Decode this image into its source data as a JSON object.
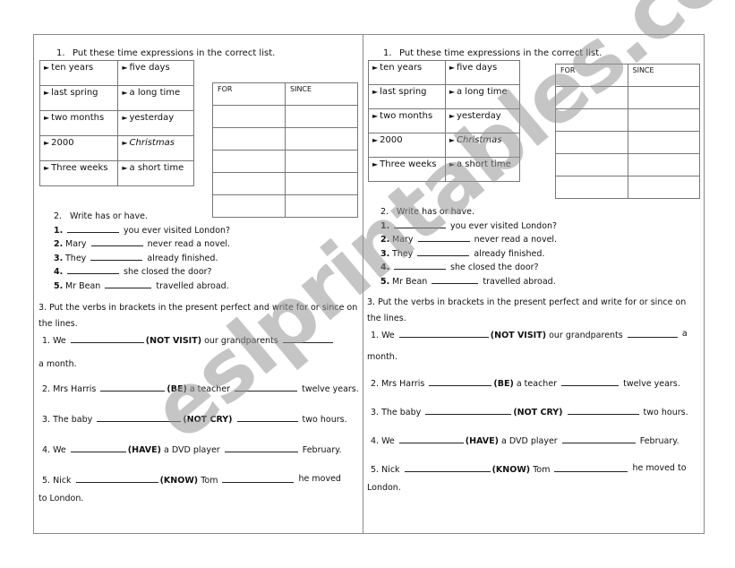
{
  "watermark": "eslprintables.com",
  "worksheet": {
    "exercise1": {
      "number": "1.",
      "title": "Put these time expressions in the correct list.",
      "expressions": [
        [
          "ten years",
          "five days"
        ],
        [
          "last spring",
          "a long time"
        ],
        [
          "two months",
          "yesterday"
        ],
        [
          "2000",
          "Christmas"
        ],
        [
          "Three weeks",
          "a short time"
        ]
      ],
      "arrow": "►",
      "columns": [
        "FOR",
        "SINCE"
      ]
    },
    "exercise2": {
      "number": "2.",
      "title": "Write has or have.",
      "items": [
        {
          "num": "1.",
          "before": "",
          "after": "you ever visited London?"
        },
        {
          "num": "2.",
          "before": "Mary",
          "after": "never read a novel."
        },
        {
          "num": "3.",
          "before": "They",
          "after": "already finished."
        },
        {
          "num": "4.",
          "before": "",
          "after": "she closed the door?"
        },
        {
          "num": "5.",
          "before": "Mr Bean",
          "after": "travelled abroad."
        }
      ]
    },
    "exercise3": {
      "title": "3. Put the verbs in brackets in the present perfect and write for or since on the lines.",
      "items": [
        {
          "start": "1. We",
          "verb": "(NOT VISIT)",
          "middle": "our grandparents",
          "end": "a month."
        },
        {
          "start": "2. Mrs Harris",
          "verb": "(BE)",
          "middle": "a teacher",
          "end": "twelve years."
        },
        {
          "start": "3. The baby",
          "verb": "(NOT CRY)",
          "middle": "",
          "end": "two hours."
        },
        {
          "start": "4. We",
          "verb": "(HAVE)",
          "middle": "a DVD player",
          "end": "February."
        },
        {
          "start": "5. Nick",
          "verb": "(KNOW)",
          "middle": "Tom",
          "end": "he moved to London."
        }
      ]
    }
  }
}
